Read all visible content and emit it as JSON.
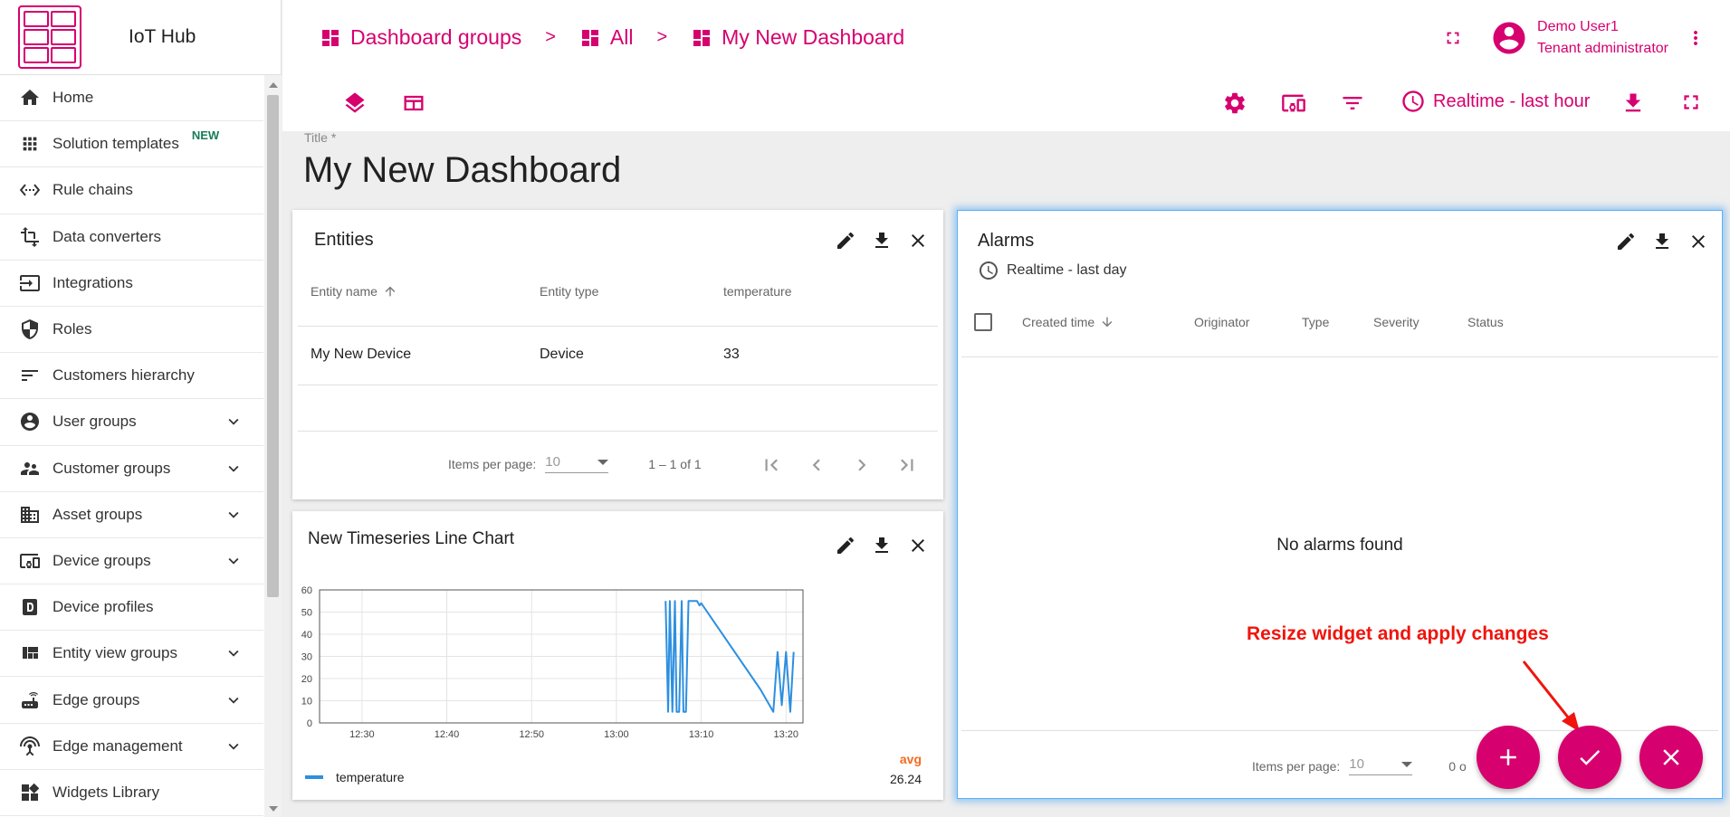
{
  "app": {
    "name": "IoT Hub"
  },
  "breadcrumb": [
    {
      "label": "Dashboard groups"
    },
    {
      "label": "All"
    },
    {
      "label": "My New Dashboard"
    }
  ],
  "breadcrumb_separator": ">",
  "user": {
    "name": "Demo User1",
    "role": "Tenant administrator"
  },
  "sidebar": {
    "items": [
      {
        "label": "Home",
        "icon": "home-icon"
      },
      {
        "label": "Solution templates",
        "icon": "apps-icon",
        "badge": "NEW"
      },
      {
        "label": "Rule chains",
        "icon": "settings-ethernet-icon"
      },
      {
        "label": "Data converters",
        "icon": "transform-icon"
      },
      {
        "label": "Integrations",
        "icon": "input-icon"
      },
      {
        "label": "Roles",
        "icon": "shield-icon"
      },
      {
        "label": "Customers hierarchy",
        "icon": "sort-icon"
      },
      {
        "label": "User groups",
        "icon": "account-circle-icon",
        "expandable": true
      },
      {
        "label": "Customer groups",
        "icon": "supervisor-icon",
        "expandable": true
      },
      {
        "label": "Asset groups",
        "icon": "domain-icon",
        "expandable": true
      },
      {
        "label": "Device groups",
        "icon": "devices-other-icon",
        "expandable": true
      },
      {
        "label": "Device profiles",
        "icon": "device-profile-icon"
      },
      {
        "label": "Entity view groups",
        "icon": "view-quilt-icon",
        "expandable": true
      },
      {
        "label": "Edge groups",
        "icon": "router-icon",
        "expandable": true
      },
      {
        "label": "Edge management",
        "icon": "settings-input-antenna-icon",
        "expandable": true
      },
      {
        "label": "Widgets Library",
        "icon": "widgets-icon"
      }
    ]
  },
  "toolbar": {
    "timewindow_label": "Realtime - last hour"
  },
  "dashboard": {
    "title_label": "Title *",
    "title": "My New Dashboard"
  },
  "entities_widget": {
    "title": "Entities",
    "columns": [
      "Entity name",
      "Entity type",
      "temperature"
    ],
    "rows": [
      {
        "name": "My New Device",
        "type": "Device",
        "temperature": "33"
      }
    ],
    "items_per_page_label": "Items per page:",
    "page_size": "10",
    "range": "1 – 1 of 1"
  },
  "chart_widget": {
    "title": "New Timeseries Line Chart",
    "legend_header": "avg",
    "legend_series": "temperature",
    "legend_value": "26.24"
  },
  "chart_data": {
    "type": "line",
    "x_tick_labels": [
      "12:30",
      "12:40",
      "12:50",
      "13:00",
      "13:10",
      "13:20"
    ],
    "y_ticks": [
      0,
      10,
      20,
      30,
      40,
      50,
      60
    ],
    "ylim": [
      0,
      60
    ],
    "xlim_minutes": [
      0,
      57
    ],
    "grid": true,
    "legend_position": "bottom",
    "series": [
      {
        "name": "temperature",
        "color": "#2d8fe0",
        "x_minutes": [
          40.8,
          41.1,
          41.3,
          41.6,
          41.9,
          42.1,
          42.4,
          42.7,
          42.9,
          43.2,
          43.5,
          44.2,
          44.5,
          44.8,
          45.0,
          52.0,
          53.5,
          54.0,
          54.5,
          55.0,
          55.5,
          55.9
        ],
        "values": [
          55,
          5,
          55,
          5,
          55,
          5,
          5,
          55,
          5,
          5,
          55,
          55,
          55,
          53,
          54,
          15,
          5,
          32,
          8,
          32,
          5,
          32
        ]
      }
    ]
  },
  "alarms_widget": {
    "title": "Alarms",
    "timewindow_label": "Realtime - last day",
    "columns": [
      "Created time",
      "Originator",
      "Type",
      "Severity",
      "Status"
    ],
    "empty_text": "No alarms found",
    "items_per_page_label": "Items per page:",
    "page_size": "10",
    "range_partial": "0 o"
  },
  "annotation": {
    "text": "Resize widget and apply changes",
    "color": "#f0140d"
  },
  "colors": {
    "accent": "#d6006f",
    "selection_glow": "#5ab1f5",
    "line": "#2d8fe0",
    "avg_label": "#f36b1f"
  }
}
